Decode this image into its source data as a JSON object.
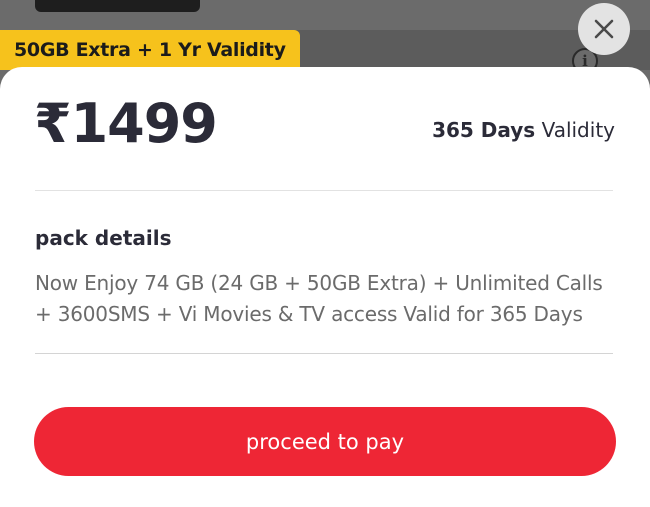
{
  "background": {
    "offer_badge": "50GB Extra + 1 Yr Validity",
    "info_icon": "info-icon"
  },
  "close_icon": "close-icon",
  "sheet": {
    "price": "₹1499",
    "validity_days": "365 Days",
    "validity_label": "Validity",
    "pack_heading": "pack details",
    "pack_description": "Now Enjoy 74 GB (24 GB + 50GB Extra) + Unlimited Calls + 3600SMS + Vi Movies & TV access Valid for 365 Days",
    "cta_label": "proceed to pay"
  },
  "colors": {
    "badge": "#f6c21c",
    "cta": "#ee2635",
    "text_primary": "#2b2b38",
    "text_secondary": "#6b6b6b"
  }
}
